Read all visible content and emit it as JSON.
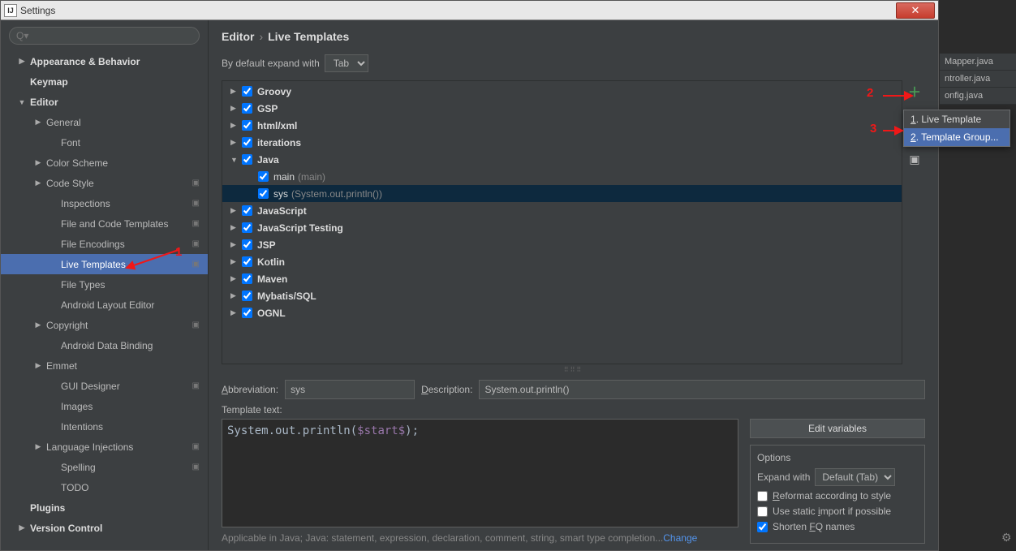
{
  "title": "Settings",
  "breadcrumb": {
    "section": "Editor",
    "page": "Live Templates"
  },
  "expand_label": "By default expand with",
  "expand_value": "Tab",
  "sidebar": {
    "items": [
      {
        "label": "Appearance & Behavior",
        "level": 1,
        "bold": true,
        "arrow": "right"
      },
      {
        "label": "Keymap",
        "level": 1,
        "bold": true,
        "arrow": "none"
      },
      {
        "label": "Editor",
        "level": 1,
        "bold": true,
        "arrow": "down"
      },
      {
        "label": "General",
        "level": 2,
        "arrow": "right"
      },
      {
        "label": "Font",
        "level": 3,
        "arrow": "none"
      },
      {
        "label": "Color Scheme",
        "level": 2,
        "arrow": "right"
      },
      {
        "label": "Code Style",
        "level": 2,
        "arrow": "right",
        "gear": true
      },
      {
        "label": "Inspections",
        "level": 3,
        "arrow": "none",
        "gear": true
      },
      {
        "label": "File and Code Templates",
        "level": 3,
        "arrow": "none",
        "gear": true
      },
      {
        "label": "File Encodings",
        "level": 3,
        "arrow": "none",
        "gear": true
      },
      {
        "label": "Live Templates",
        "level": 3,
        "arrow": "none",
        "gear": true,
        "selected": true
      },
      {
        "label": "File Types",
        "level": 3,
        "arrow": "none"
      },
      {
        "label": "Android Layout Editor",
        "level": 3,
        "arrow": "none"
      },
      {
        "label": "Copyright",
        "level": 2,
        "arrow": "right",
        "gear": true
      },
      {
        "label": "Android Data Binding",
        "level": 3,
        "arrow": "none"
      },
      {
        "label": "Emmet",
        "level": 2,
        "arrow": "right"
      },
      {
        "label": "GUI Designer",
        "level": 3,
        "arrow": "none",
        "gear": true
      },
      {
        "label": "Images",
        "level": 3,
        "arrow": "none"
      },
      {
        "label": "Intentions",
        "level": 3,
        "arrow": "none"
      },
      {
        "label": "Language Injections",
        "level": 2,
        "arrow": "right",
        "gear": true
      },
      {
        "label": "Spelling",
        "level": 3,
        "arrow": "none",
        "gear": true
      },
      {
        "label": "TODO",
        "level": 3,
        "arrow": "none"
      },
      {
        "label": "Plugins",
        "level": 1,
        "bold": true,
        "arrow": "none"
      },
      {
        "label": "Version Control",
        "level": 1,
        "bold": true,
        "arrow": "right"
      }
    ]
  },
  "templates": [
    {
      "label": "Groovy",
      "arrow": "right"
    },
    {
      "label": "GSP",
      "arrow": "right"
    },
    {
      "label": "html/xml",
      "arrow": "right"
    },
    {
      "label": "iterations",
      "arrow": "right"
    },
    {
      "label": "Java",
      "arrow": "down",
      "children": [
        {
          "label": "main",
          "hint": "(main)"
        },
        {
          "label": "sys",
          "hint": "(System.out.println())",
          "selected": true
        }
      ]
    },
    {
      "label": "JavaScript",
      "arrow": "right"
    },
    {
      "label": "JavaScript Testing",
      "arrow": "right"
    },
    {
      "label": "JSP",
      "arrow": "right"
    },
    {
      "label": "Kotlin",
      "arrow": "right"
    },
    {
      "label": "Maven",
      "arrow": "right"
    },
    {
      "label": "Mybatis/SQL",
      "arrow": "right"
    },
    {
      "label": "OGNL",
      "arrow": "right"
    }
  ],
  "form": {
    "abbr_label": "Abbreviation:",
    "abbr_value": "sys",
    "desc_label": "Description:",
    "desc_value": "System.out.println()"
  },
  "template_text_label": "Template text:",
  "template_text_plain": "System.out.println(",
  "template_text_var": "$start$",
  "template_text_tail": ");",
  "edit_vars_label": "Edit variables",
  "options": {
    "title": "Options",
    "expand_label": "Expand with",
    "expand_value": "Default (Tab)",
    "reformat": "Reformat according to style",
    "static_import": "Use static import if possible",
    "shorten": "Shorten FQ names"
  },
  "applicable_text": "Applicable in Java; Java: statement, expression, declaration, comment, string, smart type completion...",
  "applicable_link": "Change",
  "popup": {
    "item1": "1. Live Template",
    "item2": "2. Template Group..."
  },
  "annotations": {
    "n1": "1",
    "n2": "2",
    "n3": "3"
  },
  "bg_tabs": [
    "Mapper.java",
    "ntroller.java",
    "onfig.java"
  ]
}
